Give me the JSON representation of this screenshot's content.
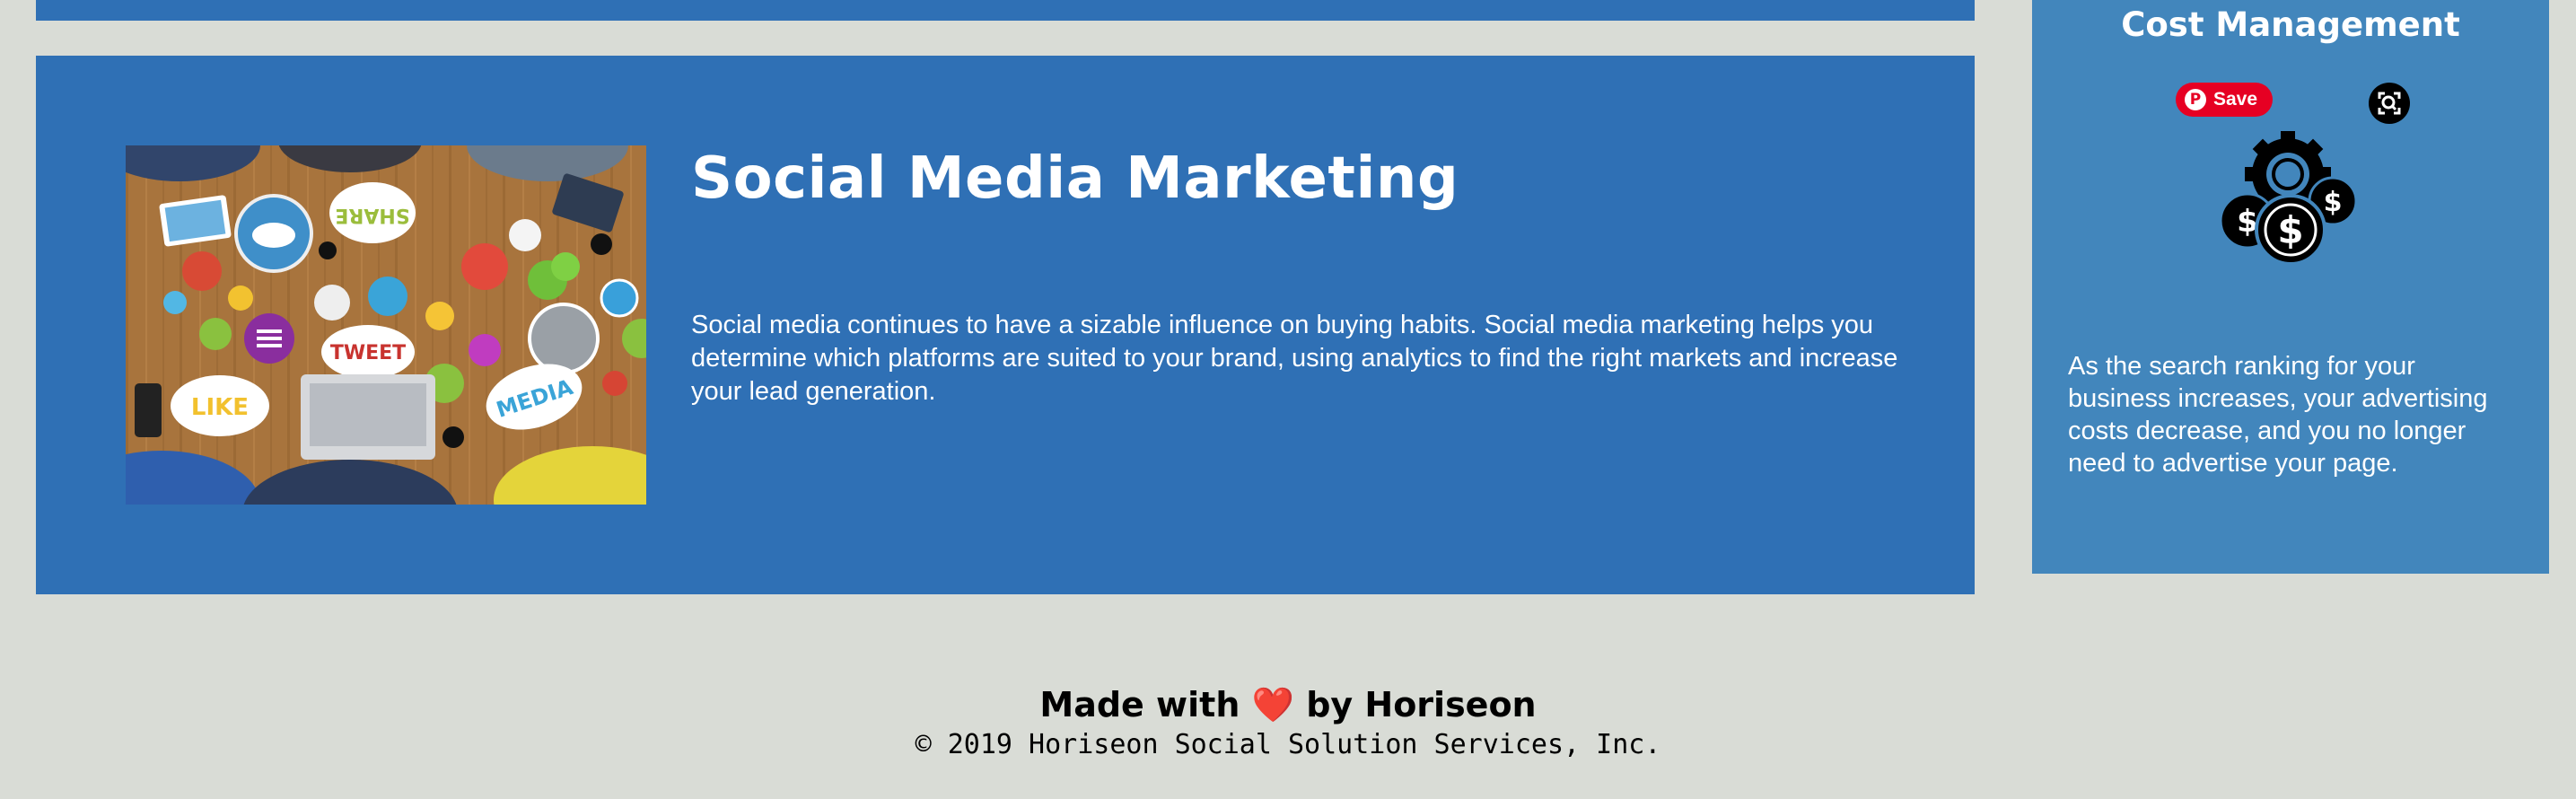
{
  "colors": {
    "page_background": "#d9dcd6",
    "content_card": "#2f70b5",
    "benefit_card": "#4286bc",
    "text_light": "#ffffff",
    "text_dark": "#000000",
    "pinterest_red": "#e60023",
    "heart_red": "#e0242b"
  },
  "content": {
    "title": "Social Media Marketing",
    "body": "Social media continues to have a sizable influence on buying habits. Social media marketing helps you determine which platforms are suited to your brand, using analytics to find the right markets and increase your lead generation.",
    "image_icon": "social-media-collage-image",
    "image_words": [
      "SHARE",
      "TWEET",
      "LIKE",
      "MEDIA"
    ]
  },
  "benefit": {
    "title": "Cost Management",
    "icon": "gear-dollar-coins-icon",
    "text": "As the search ranking for your business increases, your advertising costs decrease, and you no longer need to advertise your page."
  },
  "overlay": {
    "pin_logo": "P",
    "pin_save_label": "Save",
    "lens_icon": "visual-search-icon"
  },
  "footer": {
    "made_with_prefix": "Made with",
    "heart": "❤️",
    "made_with_suffix": "by Horiseon",
    "copyright": "© 2019 Horiseon Social Solution Services, Inc."
  }
}
